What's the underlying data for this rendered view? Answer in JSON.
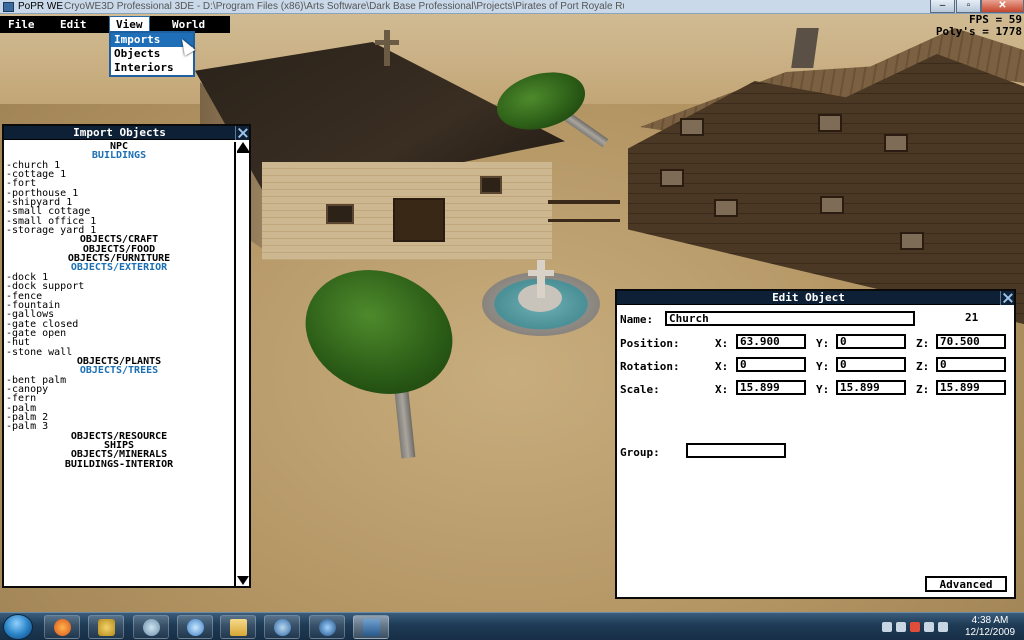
{
  "window": {
    "title": "PoPR WE",
    "path": "CryoWE3D Professional 3DE - D:\\Program Files (x86)\\Arts Software\\Dark Base Professional\\Projects\\Pirates of Port Royale Runtime Engine.dbpro"
  },
  "menu": {
    "items": [
      "File",
      "Edit",
      "View",
      "World"
    ],
    "active": "View",
    "view_dropdown": [
      "Imports",
      "Objects",
      "Interiors"
    ],
    "highlighted": "Imports"
  },
  "stats": {
    "fps_label": "FPS = 59",
    "polys_label": "Poly's = 1778"
  },
  "import_panel": {
    "title": "Import Objects",
    "items": [
      {
        "text": "NPC",
        "kind": "cat"
      },
      {
        "text": "BUILDINGS",
        "kind": "catblue"
      },
      {
        "text": "-church 1",
        "kind": "item"
      },
      {
        "text": "-cottage 1",
        "kind": "item"
      },
      {
        "text": "-fort",
        "kind": "item"
      },
      {
        "text": "-porthouse 1",
        "kind": "item"
      },
      {
        "text": "-shipyard 1",
        "kind": "item"
      },
      {
        "text": "-small cottage",
        "kind": "item"
      },
      {
        "text": "-small office 1",
        "kind": "item"
      },
      {
        "text": "-storage yard 1",
        "kind": "item"
      },
      {
        "text": "OBJECTS/CRAFT",
        "kind": "cat"
      },
      {
        "text": "OBJECTS/FOOD",
        "kind": "cat"
      },
      {
        "text": "OBJECTS/FURNITURE",
        "kind": "cat"
      },
      {
        "text": "OBJECTS/EXTERIOR",
        "kind": "catblue"
      },
      {
        "text": "-dock 1",
        "kind": "item"
      },
      {
        "text": "-dock support",
        "kind": "item"
      },
      {
        "text": "-fence",
        "kind": "item"
      },
      {
        "text": "-fountain",
        "kind": "item"
      },
      {
        "text": "-gallows",
        "kind": "item"
      },
      {
        "text": "-gate closed",
        "kind": "item"
      },
      {
        "text": "-gate open",
        "kind": "item"
      },
      {
        "text": "-hut",
        "kind": "item"
      },
      {
        "text": "-stone wall",
        "kind": "item"
      },
      {
        "text": "OBJECTS/PLANTS",
        "kind": "cat"
      },
      {
        "text": "OBJECTS/TREES",
        "kind": "catblue"
      },
      {
        "text": "-bent palm",
        "kind": "item"
      },
      {
        "text": "-canopy",
        "kind": "item"
      },
      {
        "text": "-fern",
        "kind": "item"
      },
      {
        "text": "-palm",
        "kind": "item"
      },
      {
        "text": "-palm 2",
        "kind": "item"
      },
      {
        "text": "-palm 3",
        "kind": "item"
      },
      {
        "text": "OBJECTS/RESOURCE",
        "kind": "cat"
      },
      {
        "text": "SHIPS",
        "kind": "cat"
      },
      {
        "text": "OBJECTS/MINERALS",
        "kind": "cat"
      },
      {
        "text": "BUILDINGS-INTERIOR",
        "kind": "cat"
      }
    ]
  },
  "edit_panel": {
    "title": "Edit Object",
    "name_label": "Name:",
    "name_value": "Church",
    "object_id": "21",
    "position_label": "Position:",
    "rotation_label": "Rotation:",
    "scale_label": "Scale:",
    "x_label": "X:",
    "y_label": "Y:",
    "z_label": "Z:",
    "position": {
      "x": "63.900",
      "y": "0",
      "z": "70.500"
    },
    "rotation": {
      "x": "0",
      "y": "0",
      "z": "0"
    },
    "scale": {
      "x": "15.899",
      "y": "15.899",
      "z": "15.899"
    },
    "group_label": "Group:",
    "group_value": "",
    "advanced_label": "Advanced"
  },
  "taskbar": {
    "time": "4:38 AM",
    "date": "12/12/2009"
  },
  "colors": {
    "panel_title_bg": "#0e2036",
    "category_blue": "#1a6fb5",
    "menu_highlight": "#1e6fb8"
  }
}
